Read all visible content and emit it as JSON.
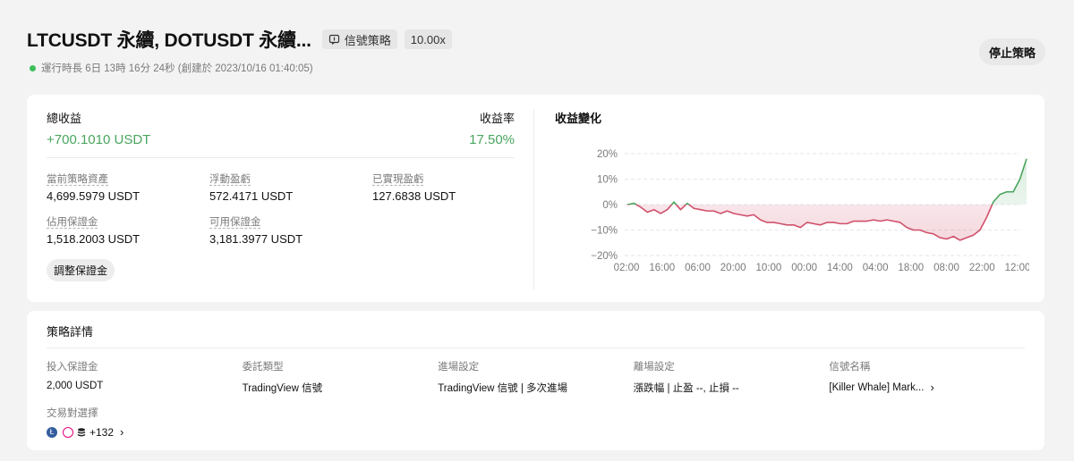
{
  "header": {
    "title": "LTCUSDT 永續, DOTUSDT 永續...",
    "strategy_tag": "信號策略",
    "leverage_tag": "10.00x",
    "runtime": "運行時長 6日 13時 16分 24秒 (創建於 2023/10/16 01:40:05)",
    "stop_button": "停止策略"
  },
  "summary": {
    "total_profit_label": "總收益",
    "total_profit_value": "+700.1010 USDT",
    "yield_label": "收益率",
    "yield_value": "17.50%",
    "stats": [
      {
        "label": "當前策略資產",
        "value": "4,699.5979 USDT"
      },
      {
        "label": "浮動盈虧",
        "value": "572.4171 USDT"
      },
      {
        "label": "已實現盈虧",
        "value": "127.6838 USDT"
      },
      {
        "label": "佔用保證金",
        "value": "1,518.2003 USDT"
      },
      {
        "label": "可用保證金",
        "value": "3,181.3977 USDT"
      }
    ],
    "adjust_button": "調整保證金"
  },
  "chart": {
    "title": "收益變化",
    "y_ticks": [
      "20%",
      "10%",
      "0%",
      "−10%",
      "−20%"
    ],
    "x_ticks": [
      "02:00",
      "16:00",
      "06:00",
      "20:00",
      "10:00",
      "00:00",
      "14:00",
      "04:00",
      "18:00",
      "08:00",
      "22:00",
      "12:00"
    ],
    "positive_color": "#4aa55e",
    "negative_color": "#d0506a"
  },
  "chart_data": {
    "type": "line",
    "title": "收益變化",
    "xlabel": "",
    "ylabel": "",
    "ylim": [
      -20,
      20
    ],
    "y_unit": "%",
    "x": [
      "02:00",
      "16:00",
      "06:00",
      "20:00",
      "10:00",
      "00:00",
      "14:00",
      "04:00",
      "18:00",
      "08:00",
      "22:00",
      "12:00"
    ],
    "series": [
      {
        "values": [
          0,
          0.5,
          -1,
          -3,
          -2,
          -3.5,
          -2,
          1,
          -2,
          0.5,
          -1.5,
          -2,
          -2.5,
          -2.5,
          -3.5,
          -2.5,
          -3.5,
          -4,
          -4.5,
          -4,
          -6,
          -7,
          -7,
          -7.5,
          -8,
          -8,
          -9,
          -7,
          -7.5,
          -8,
          -7,
          -7,
          -7.5,
          -7.5,
          -6.5,
          -6.5,
          -6.5,
          -6,
          -6.5,
          -6,
          -6.5,
          -7,
          -9,
          -10,
          -10,
          -11,
          -11.5,
          -13,
          -13.5,
          -12.5,
          -14,
          -13,
          -12,
          -10,
          -5,
          1,
          4,
          5,
          5,
          10,
          18
        ]
      }
    ],
    "grid": true,
    "legend": "none"
  },
  "details": {
    "title": "策略詳情",
    "fields": [
      {
        "label": "投入保證金",
        "value": "2,000 USDT"
      },
      {
        "label": "委託類型",
        "value": "TradingView 信號"
      },
      {
        "label": "進場設定",
        "value": "TradingView 信號 | 多次進場"
      },
      {
        "label": "離場設定",
        "value": "漲跌幅 | 止盈 --, 止損 --"
      },
      {
        "label": "信號名稱",
        "value": "[Killer Whale] Mark..."
      }
    ],
    "pairs_label": "交易對選擇",
    "pairs_more": "+132"
  }
}
